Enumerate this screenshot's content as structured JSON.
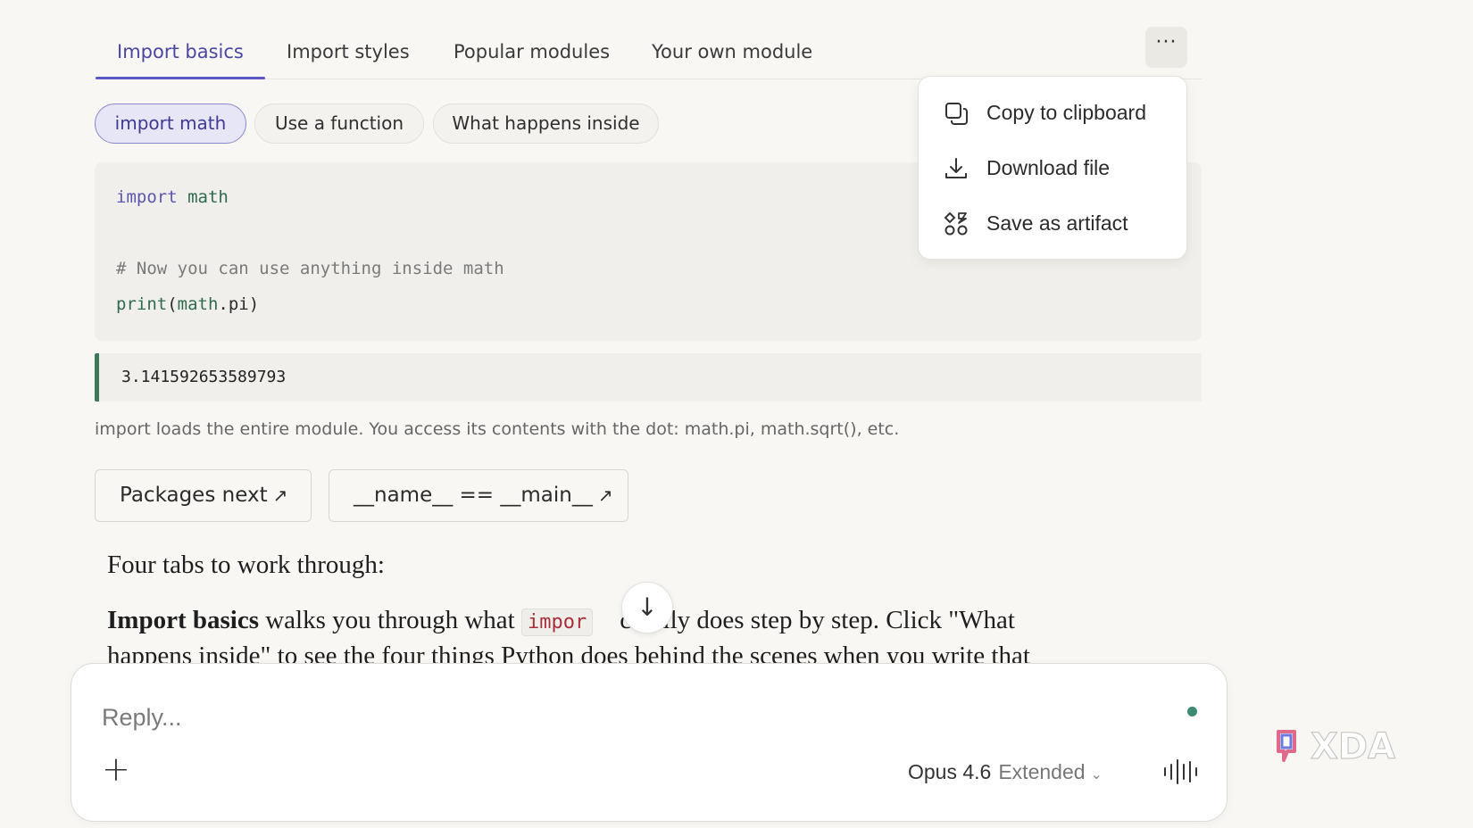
{
  "tabs": [
    {
      "label": "Import basics",
      "active": true
    },
    {
      "label": "Import styles",
      "active": false
    },
    {
      "label": "Popular modules",
      "active": false
    },
    {
      "label": "Your own module",
      "active": false
    }
  ],
  "more_button": {
    "label": "···"
  },
  "pills": [
    {
      "label": "import math",
      "active": true
    },
    {
      "label": "Use a function",
      "active": false
    },
    {
      "label": "What happens inside",
      "active": false
    }
  ],
  "code": {
    "line1_kw": "import",
    "line1_mod": "math",
    "line3": "# Now you can use anything inside math",
    "line4_fn": "print",
    "line4_open": "(",
    "line4_obj": "math",
    "line4_rest": ".pi)"
  },
  "output": "3.141592653589793",
  "note": "import loads the entire module. You access its contents with the dot: math.pi, math.sqrt(), etc.",
  "links": [
    {
      "label": "Packages next",
      "arrow": "↗"
    },
    {
      "label": "__name__ == __main__",
      "arrow": "↗"
    }
  ],
  "prose": {
    "heading": "Four tabs to work through:",
    "bold": "Import basics",
    "before_code": " walks you through what ",
    "code": "impor",
    "after_code": "ctually does step by step. Click \"What",
    "line2": "happens inside\" to see the four things Python does behind the scenes when you write that"
  },
  "scroll_button": {
    "icon": "arrow-down-icon",
    "glyph": "↓"
  },
  "composer": {
    "placeholder": "Reply...",
    "plus": "+",
    "model": "Opus 4.6",
    "variant": "Extended",
    "chevron": "⌄"
  },
  "menu": {
    "items": [
      {
        "label": "Copy to clipboard",
        "icon": "copy-icon"
      },
      {
        "label": "Download file",
        "icon": "download-icon"
      },
      {
        "label": "Save as artifact",
        "icon": "artifact-icon"
      }
    ]
  },
  "watermark": {
    "text": "XDA"
  },
  "colors": {
    "accent": "#5b57c4",
    "output_border": "#3d7a58",
    "status_dot": "#3c8a73",
    "inline_code": "#a8303a"
  }
}
